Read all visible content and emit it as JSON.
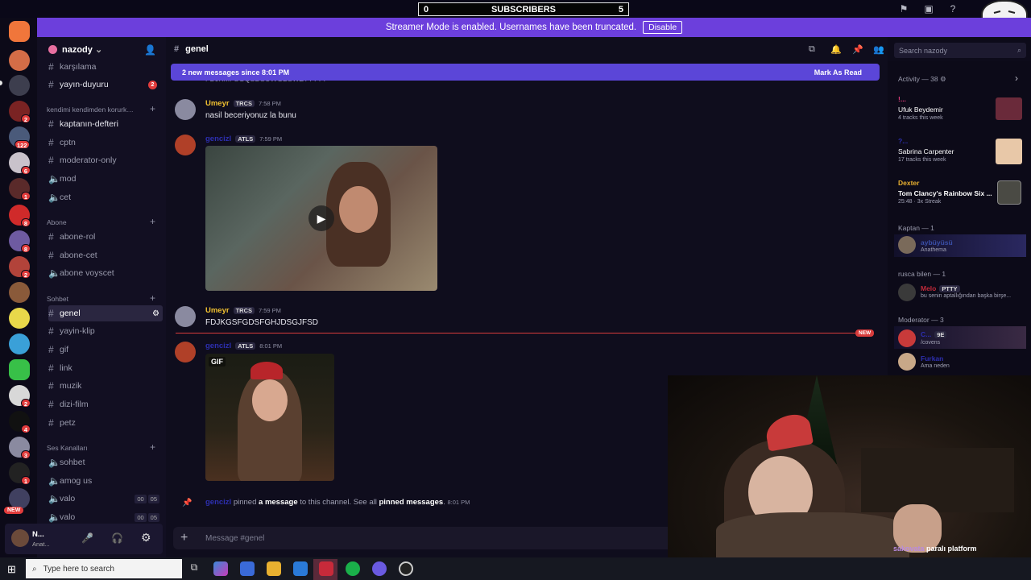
{
  "overlay": {
    "subscribers_label": "SUBSCRIBERS",
    "sub_left": "0",
    "sub_right": "5"
  },
  "streamer": {
    "text": "Streamer Mode is enabled. Usernames have been truncated.",
    "button": "Disable"
  },
  "server": {
    "name": "nazody"
  },
  "rail_badges": [
    "2",
    "122",
    "6",
    "1",
    "8",
    "8",
    "2",
    "2",
    "4",
    "3",
    "1"
  ],
  "rail_new": "NEW",
  "channels": {
    "top": [
      {
        "name": "karşılama"
      },
      {
        "name": "yayın-duyuru",
        "badge": "2"
      }
    ],
    "cat1": "kendimi kendimden korurk…",
    "group1": [
      "kaptanın-defteri",
      "cptn",
      "moderator-only",
      "mod",
      "cet"
    ],
    "cat2": "Abone",
    "group2": [
      "abone-rol",
      "abone-cet",
      "abone voyscet"
    ],
    "cat3": "Sohbet",
    "group3": [
      "genel",
      "yayin-klip",
      "gif",
      "link",
      "muzik",
      "dizi-film",
      "petz"
    ],
    "cat4": "Ses Kanalları",
    "voice": [
      {
        "name": "sohbet"
      },
      {
        "name": "amog us"
      },
      {
        "name": "valo",
        "a": "00",
        "b": "05"
      },
      {
        "name": "valo",
        "a": "00",
        "b": "05"
      }
    ]
  },
  "user": {
    "name": "N...",
    "status": "Anat..."
  },
  "header": {
    "channel": "genel",
    "search_placeholder": "Search nazody"
  },
  "newbar": {
    "text": "2 new messages since 8:01 PM",
    "action": "Mark As Read"
  },
  "cutoff_text": "FDJKMFSGQSDSUWGBSWZTYTYT",
  "messages": [
    {
      "user": "Umeyr",
      "tag": "TRCS",
      "time": "7:58 PM",
      "text": "nasil beceriyonuz la bunu"
    },
    {
      "user": "gencizl",
      "tag": "ATLS",
      "time": "7:59 PM"
    },
    {
      "user": "Umeyr",
      "tag": "TRCS",
      "time": "7:59 PM",
      "text": "FDJKGSFGDSFGHJDSGJFSD"
    },
    {
      "user": "gencizl",
      "tag": "ATLS",
      "time": "8:01 PM",
      "media": "GIF"
    }
  ],
  "new_divider": "NEW",
  "system": {
    "user": "gencizl",
    "a": "pinned",
    "b": "a message",
    "c": "to this channel. See all",
    "d": "pinned messages",
    "e": ".",
    "time": "8:01 PM"
  },
  "composer": {
    "placeholder": "Message #genel"
  },
  "members": {
    "activity_header": "Activity — 38",
    "activities": [
      {
        "name": "!...",
        "title": "Ufuk Beydemir",
        "sub": "4 tracks this week"
      },
      {
        "name": "?...",
        "title": "Sabrina Carpenter",
        "sub": "17 tracks this week"
      },
      {
        "name": "Dexter",
        "title": "Tom Clancy's Rainbow Six ...",
        "sub": "25:48 · 3x Streak"
      }
    ],
    "cat_kaptan": "Kaptan — 1",
    "kaptan": {
      "name": "aybüyüsü",
      "sub": "Anathema"
    },
    "cat_rusca": "rusca bilen — 1",
    "rusca": {
      "name": "Melo",
      "tag": "PTTY",
      "sub": "bu senin aptallığından başka birşe..."
    },
    "cat_mod": "Moderator — 3",
    "mods": [
      {
        "name": "C...",
        "tag": "9E",
        "sub": "/covens"
      },
      {
        "name": "Furkan",
        "sub": "Ama neden"
      }
    ]
  },
  "webcam": {
    "caption_user": "sakovata",
    "caption_text": "paralı platform"
  },
  "taskbar": {
    "search": "Type here to search"
  }
}
